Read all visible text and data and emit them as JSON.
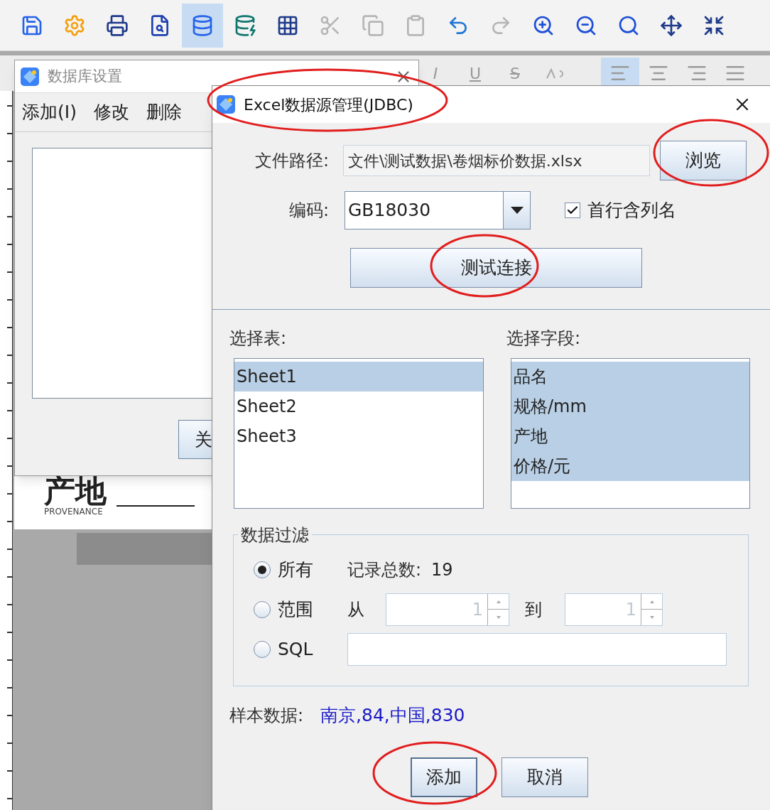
{
  "toolbar": {
    "buttons": [
      {
        "selected": false,
        "disabled": false
      },
      {
        "selected": false,
        "disabled": false
      },
      {
        "selected": false,
        "disabled": false
      },
      {
        "selected": false,
        "disabled": false
      },
      {
        "selected": true,
        "disabled": false
      },
      {
        "selected": false,
        "disabled": false
      },
      {
        "selected": false,
        "disabled": false
      },
      {
        "selected": false,
        "disabled": true
      },
      {
        "selected": false,
        "disabled": true
      },
      {
        "selected": false,
        "disabled": true
      },
      {
        "selected": false,
        "disabled": false
      },
      {
        "selected": false,
        "disabled": true
      },
      {
        "selected": false,
        "disabled": false
      },
      {
        "selected": false,
        "disabled": false
      },
      {
        "selected": false,
        "disabled": false
      },
      {
        "selected": false,
        "disabled": false
      },
      {
        "selected": false,
        "disabled": false
      }
    ]
  },
  "format_bar": {
    "styles": [
      {
        "label": "I"
      },
      {
        "label": "U"
      },
      {
        "label": "S"
      }
    ],
    "align": [
      {
        "selected": true
      },
      {
        "selected": false
      },
      {
        "selected": false
      },
      {
        "selected": false
      }
    ]
  },
  "canvas": {
    "label": "产地",
    "sublabel": "PROVENANCE"
  },
  "background_dialog": {
    "title": "数据库设置",
    "menu": [
      "添加(I)",
      "修改",
      "删除"
    ],
    "button": "关"
  },
  "dialog": {
    "title": "Excel数据源管理(JDBC)",
    "file_path": {
      "label": "文件路径:",
      "value": "文件\\测试数据\\卷烟标价数据.xlsx"
    },
    "browse_button": "浏览",
    "encoding": {
      "label": "编码:",
      "value": "GB18030"
    },
    "header_row": {
      "label": "首行含列名",
      "checked": true
    },
    "test_button": "测试连接",
    "tables": {
      "label": "选择表:",
      "items": [
        {
          "label": "Sheet1",
          "selected": true
        },
        {
          "label": "Sheet2",
          "selected": false
        },
        {
          "label": "Sheet3",
          "selected": false
        }
      ]
    },
    "fields": {
      "label": "选择字段:",
      "items": [
        {
          "label": "品名",
          "selected": true
        },
        {
          "label": "规格/mm",
          "selected": true
        },
        {
          "label": "产地",
          "selected": true
        },
        {
          "label": "价格/元",
          "selected": true
        }
      ]
    },
    "filter": {
      "title": "数据过滤",
      "options": [
        {
          "kind": "all",
          "label": "所有",
          "selected": true
        },
        {
          "kind": "range",
          "label": "范围",
          "selected": false
        },
        {
          "kind": "sql",
          "label": "SQL",
          "selected": false
        }
      ],
      "record_count_label": "记录总数:",
      "record_count": "19",
      "from_label": "从",
      "from_value": "1",
      "to_label": "到",
      "to_value": "1"
    },
    "sample": {
      "label": "样本数据:",
      "value": "南京,84,中国,830"
    },
    "buttons": [
      {
        "label": "添加",
        "default": true
      },
      {
        "label": "取消",
        "default": false
      }
    ]
  }
}
